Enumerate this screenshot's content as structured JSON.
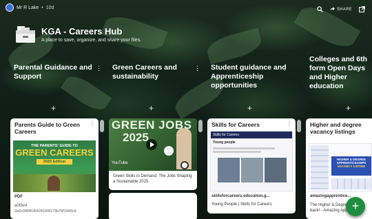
{
  "topbar": {
    "user_name": "Mr R Lake",
    "separator": "•",
    "post_count": "10d",
    "share_label": "SHARE"
  },
  "header": {
    "title": "KGA - Careers Hub",
    "subtitle": "A place to save, organize, and share your files."
  },
  "columns": [
    {
      "name": "Parental Guidance and Support",
      "card": {
        "title": "Parents Guide to Green Careers",
        "image_lines": [
          "THE PARENTS' GUIDE TO",
          "GREEN CAREERS",
          "2025 Edition"
        ],
        "file_type": "PDF",
        "file_id_1": "a0f9e4",
        "file_id_2": "2e6c09f9f1f6424190f173b75f1049c9"
      }
    },
    {
      "name": "Green Careers and sustainability",
      "card": {
        "image_text_1": "GREEN JOBS",
        "image_text_2": "2025",
        "source": "YouTube",
        "caption": "Green Skills in Demand: The Jobs Shaping a Sustainable 2025"
      }
    },
    {
      "name": "Student guidance and Apprenticeship opportunities",
      "card": {
        "title": "Skills for Careers",
        "site_title": "Skills for Careers",
        "site_heading": "Young people",
        "domain": "skillsforcareers.education.g...",
        "caption": "Young People | Skills for Careers"
      }
    },
    {
      "name": "Colleges and 6th form Open Days and Higher education",
      "card": {
        "title": "Higher and degree vacancy listings",
        "badge_lines": [
          "HIGHER & DEGREE",
          "APPRENTICESHIPS",
          "VACANCY LISTING"
        ],
        "domain": "amazingapprentice...",
        "caption": "The Higher & Degree... back! - Amazing App..."
      }
    }
  ],
  "colors": {
    "accent_green": "#1e8e3e",
    "card_bg": "#ffffff",
    "dark_bg": "#0f1a12"
  },
  "icons": [
    "search-icon",
    "share-icon",
    "open-external-icon",
    "kebab-menu-icon",
    "plus-icon",
    "play-icon"
  ]
}
